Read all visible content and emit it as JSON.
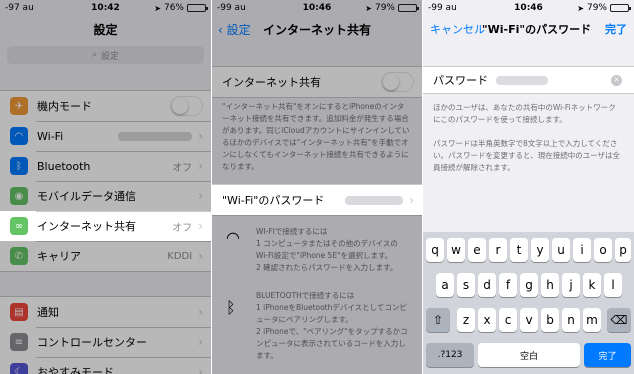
{
  "panel1": {
    "status": {
      "signal": "-97 au",
      "time": "10:42",
      "battery": "76%"
    },
    "title": "設定",
    "search_placeholder": "設定",
    "rows": [
      {
        "label": "機内モード",
        "value": ""
      },
      {
        "label": "Wi-Fi",
        "value": ""
      },
      {
        "label": "Bluetooth",
        "value": "オフ"
      },
      {
        "label": "モバイルデータ通信",
        "value": ""
      },
      {
        "label": "インターネット共有",
        "value": "オフ"
      },
      {
        "label": "キャリア",
        "value": "KDDI"
      }
    ],
    "rows2": [
      {
        "label": "通知"
      },
      {
        "label": "コントロールセンター"
      },
      {
        "label": "おやすみモード"
      }
    ]
  },
  "panel2": {
    "status": {
      "signal": "-99 au",
      "time": "10:46",
      "battery": "79%"
    },
    "back_label": "設定",
    "title": "インターネット共有",
    "toggle_label": "インターネット共有",
    "toggle_note": "\"インターネット共有\"をオンにするとiPhoneのインターネット接続を共有できます。追加料金が発生する場合があります。同じiCloudアカウントにサインインしているほかのデバイスでは\"インターネット共有\"を手動でオンにしなくてもインターネット接続を共有できるようになります。",
    "wifi_pw_label": "\"Wi-Fi\"のパスワード",
    "wifi_heading": "WI-FIで接続するには",
    "wifi_step1": "1 コンピュータまたはその他のデバイスの Wi-Fi設定で\"iPhone 5E\"を選択します。",
    "wifi_step2": "2 確認されたらパスワードを入力します。",
    "bt_heading": "BLUETOOTHで接続するには",
    "bt_step1": "1 iPhoneをBluetoothデバイスとしてコンピュータにペアリングします。",
    "bt_step2": "2 iPhoneで、\"ペアリング\"をタップするかコンピュータに表示されているコードを入力します。"
  },
  "panel3": {
    "status": {
      "signal": "-99 au",
      "time": "10:46",
      "battery": "79%"
    },
    "cancel_label": "キャンセル",
    "title": "\"Wi-Fi\"のパスワード",
    "done_label": "完了",
    "password_label": "パスワード",
    "note1": "ほかのユーザは、あなたの共有中のWi-Fiネットワークにこのパスワードを使って接続します。",
    "note2": "パスワードは半角英数字で8文字以上で入力してください。パスワードを変更すると、現在接続中のユーザは全員接続が解除されます。",
    "keyboard": {
      "row1": [
        "q",
        "w",
        "e",
        "r",
        "t",
        "y",
        "u",
        "i",
        "o",
        "p"
      ],
      "row2": [
        "a",
        "s",
        "d",
        "f",
        "g",
        "h",
        "j",
        "k",
        "l"
      ],
      "row3": [
        "z",
        "x",
        "c",
        "v",
        "b",
        "n",
        "m"
      ],
      "numbers_key": ".?123",
      "space_key": "空白",
      "done_key": "完了"
    }
  },
  "icons": {
    "airplane": "airplane-icon",
    "wifi": "wifi-icon",
    "bluetooth": "bluetooth-icon",
    "cellular": "cellular-icon",
    "hotspot": "hotspot-icon",
    "carrier": "phone-icon",
    "notifications": "notifications-icon",
    "control_center": "control-center-icon",
    "dnd": "moon-icon"
  },
  "colors": {
    "accent": "#007aff",
    "airplane": "#f19a37",
    "wifi": "#007aff",
    "bluetooth": "#007aff",
    "cellular": "#65c466",
    "hotspot": "#65c466",
    "carrier": "#65c466",
    "notifications": "#f0483e",
    "control_center": "#8e8e93",
    "dnd": "#5856d6"
  }
}
